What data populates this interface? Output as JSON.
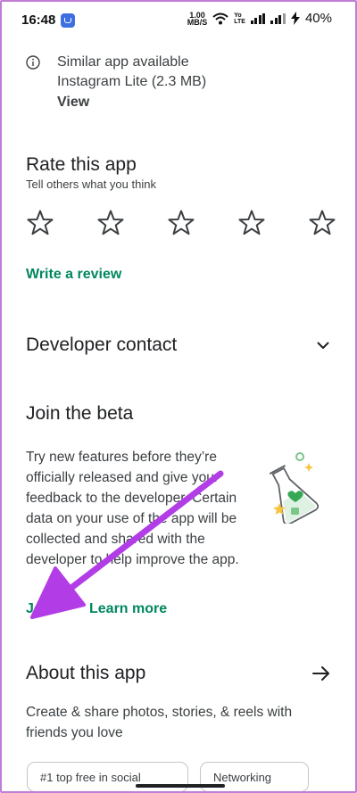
{
  "status_bar": {
    "time": "16:48",
    "speed_value": "1.00",
    "speed_unit": "MB/S",
    "volte_top": "Yo",
    "volte_bottom": "LTE",
    "battery": "40%"
  },
  "similar_app": {
    "title": "Similar app available",
    "app": "Instagram Lite (2.3 MB)",
    "action": "View"
  },
  "rate": {
    "title": "Rate this app",
    "subtitle": "Tell others what you think",
    "stars_count": 5,
    "write_review": "Write a review"
  },
  "developer_contact": {
    "title": "Developer contact"
  },
  "beta": {
    "title": "Join the beta",
    "description": "Try new features before they’re officially released and give your feedback to the developer. Certain data on your use of the app will be collected and shared with the developer to help improve the app.",
    "join": "Join",
    "learn_more": "Learn more"
  },
  "about": {
    "title": "About this app",
    "description": "Create & share photos, stories, & reels with friends you love",
    "chips": [
      "#1 top free in social",
      "Networking"
    ]
  },
  "colors": {
    "accent_green": "#01875f",
    "annotation_arrow": "#b23de6",
    "frame_border": "#c07ed6"
  }
}
